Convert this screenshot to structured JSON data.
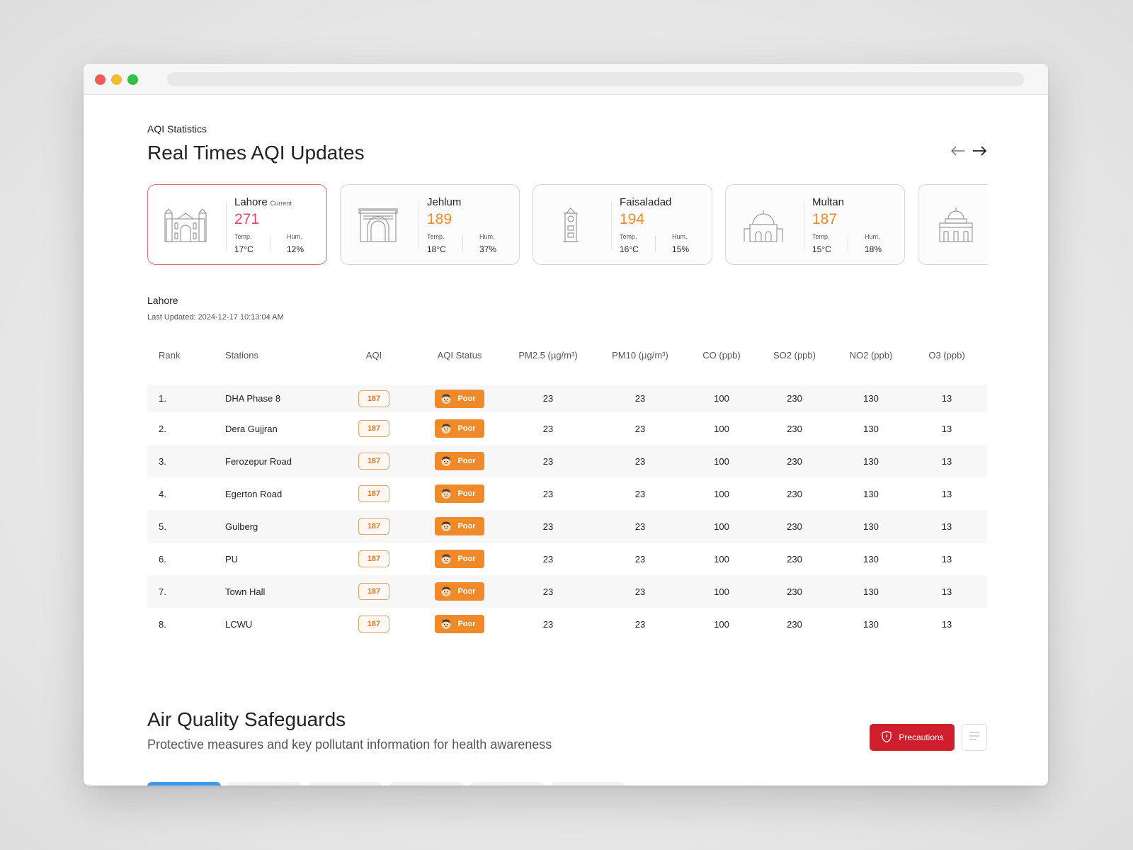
{
  "header": {
    "eyebrow": "AQI Statistics",
    "title": "Real Times AQI Updates"
  },
  "cards": [
    {
      "name": "Lahore",
      "badge": "Current",
      "aqi": "271",
      "aqi_color": "#e24b66",
      "temp_label": "Temp.",
      "temp": "17°C",
      "hum_label": "Hum.",
      "hum": "12%",
      "icon": "fort-gate-icon",
      "active": true
    },
    {
      "name": "Jehlum",
      "badge": "",
      "aqi": "189",
      "aqi_color": "#ef8a2a",
      "temp_label": "Temp.",
      "temp": "18°C",
      "hum_label": "Hum.",
      "hum": "37%",
      "icon": "arch-gate-icon",
      "active": false
    },
    {
      "name": "Faisaladad",
      "badge": "",
      "aqi": "194",
      "aqi_color": "#ef8a2a",
      "temp_label": "Temp.",
      "temp": "16°C",
      "hum_label": "Hum.",
      "hum": "15%",
      "icon": "clock-tower-icon",
      "active": false
    },
    {
      "name": "Multan",
      "badge": "",
      "aqi": "187",
      "aqi_color": "#ef8a2a",
      "temp_label": "Temp.",
      "temp": "15°C",
      "hum_label": "Hum.",
      "hum": "18%",
      "icon": "shrine-dome-icon",
      "active": false
    },
    {
      "name": "",
      "badge": "",
      "aqi": "",
      "aqi_color": "#ef8a2a",
      "temp_label": "",
      "temp": "",
      "hum_label": "",
      "hum": "",
      "icon": "palace-dome-icon",
      "active": false
    }
  ],
  "details": {
    "city": "Lahore",
    "last_updated": "Last Updated: 2024-12-17 10:13:04 AM"
  },
  "table": {
    "columns": [
      "Rank",
      "Stations",
      "AQI",
      "AQI Status",
      "PM2.5 (µg/m³)",
      "PM10 (µg/m³)",
      "CO (ppb)",
      "SO2 (ppb)",
      "NO2 (ppb)",
      "O3 (ppb)"
    ],
    "rows": [
      {
        "rank": "1.",
        "station": "DHA Phase 8",
        "aqi": "187",
        "status": "Poor",
        "pm25": "23",
        "pm10": "23",
        "co": "100",
        "so2": "230",
        "no2": "130",
        "o3": "13"
      },
      {
        "rank": "2.",
        "station": "Dera Gujjran",
        "aqi": "187",
        "status": "Poor",
        "pm25": "23",
        "pm10": "23",
        "co": "100",
        "so2": "230",
        "no2": "130",
        "o3": "13"
      },
      {
        "rank": "3.",
        "station": "Ferozepur Road",
        "aqi": "187",
        "status": "Poor",
        "pm25": "23",
        "pm10": "23",
        "co": "100",
        "so2": "230",
        "no2": "130",
        "o3": "13"
      },
      {
        "rank": "4.",
        "station": "Egerton Road",
        "aqi": "187",
        "status": "Poor",
        "pm25": "23",
        "pm10": "23",
        "co": "100",
        "so2": "230",
        "no2": "130",
        "o3": "13"
      },
      {
        "rank": "5.",
        "station": "Gulberg",
        "aqi": "187",
        "status": "Poor",
        "pm25": "23",
        "pm10": "23",
        "co": "100",
        "so2": "230",
        "no2": "130",
        "o3": "13"
      },
      {
        "rank": "6.",
        "station": "PU",
        "aqi": "187",
        "status": "Poor",
        "pm25": "23",
        "pm10": "23",
        "co": "100",
        "so2": "230",
        "no2": "130",
        "o3": "13"
      },
      {
        "rank": "7.",
        "station": "Town Hall",
        "aqi": "187",
        "status": "Poor",
        "pm25": "23",
        "pm10": "23",
        "co": "100",
        "so2": "230",
        "no2": "130",
        "o3": "13"
      },
      {
        "rank": "8.",
        "station": "LCWU",
        "aqi": "187",
        "status": "Poor",
        "pm25": "23",
        "pm10": "23",
        "co": "100",
        "so2": "230",
        "no2": "130",
        "o3": "13"
      }
    ]
  },
  "safeguards": {
    "title": "Air Quality Safeguards",
    "subtitle": "Protective measures and key pollutant information for health awareness",
    "precautions_label": "Precautions"
  },
  "colors": {
    "accent_red": "#cf1f2e",
    "poor_orange": "#ef8a2a",
    "active_card_border": "#e26a7a",
    "active_tab_blue": "#3a9af2"
  }
}
